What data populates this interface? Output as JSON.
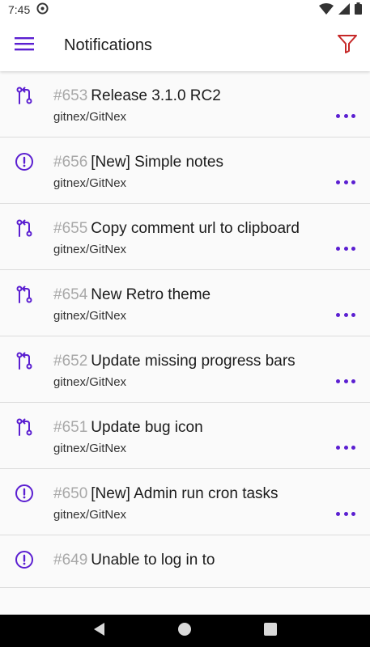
{
  "status_bar": {
    "time": "7:45"
  },
  "app_bar": {
    "title": "Notifications"
  },
  "colors": {
    "accent": "#5b1fd1",
    "filter": "#c62828"
  },
  "notifications": [
    {
      "number": "#653",
      "title": "Release 3.1.0 RC2",
      "repo": "gitnex/GitNex",
      "type": "pull-request-icon"
    },
    {
      "number": "#656",
      "title": "[New] Simple notes",
      "repo": "gitnex/GitNex",
      "type": "issue-icon"
    },
    {
      "number": "#655",
      "title": "Copy comment url to clipboard",
      "repo": "gitnex/GitNex",
      "type": "pull-request-icon"
    },
    {
      "number": "#654",
      "title": "New Retro theme",
      "repo": "gitnex/GitNex",
      "type": "pull-request-icon"
    },
    {
      "number": "#652",
      "title": "Update missing progress bars",
      "repo": "gitnex/GitNex",
      "type": "pull-request-icon"
    },
    {
      "number": "#651",
      "title": "Update bug icon",
      "repo": "gitnex/GitNex",
      "type": "pull-request-icon"
    },
    {
      "number": "#650",
      "title": "[New] Admin run cron tasks",
      "repo": "gitnex/GitNex",
      "type": "issue-icon"
    },
    {
      "number": "#649",
      "title": "Unable to log in to",
      "repo": "",
      "type": "issue-icon"
    }
  ]
}
